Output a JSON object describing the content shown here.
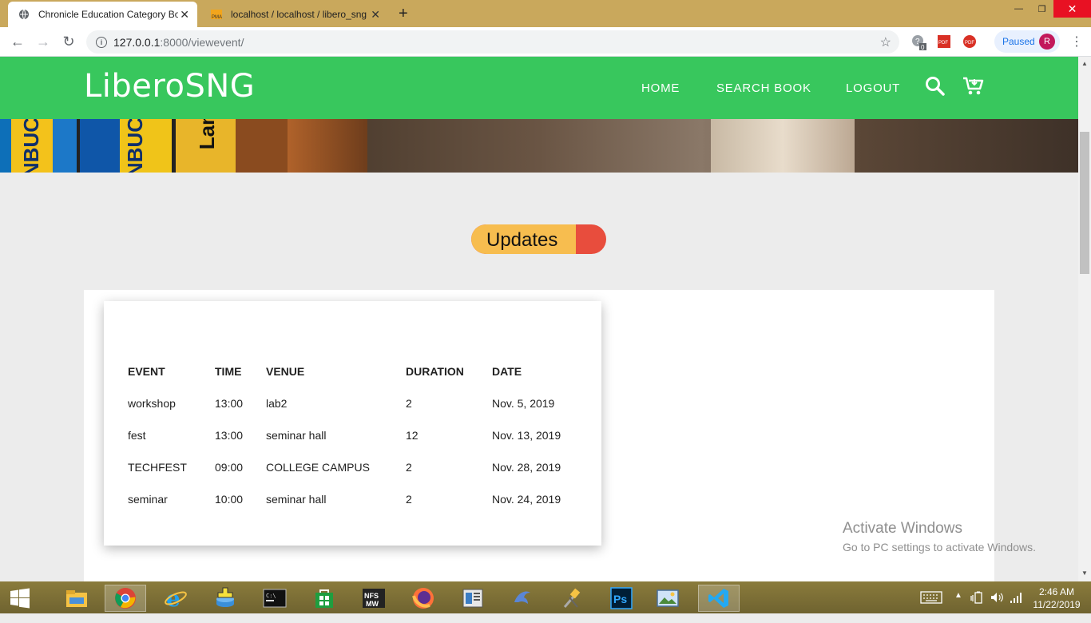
{
  "browser": {
    "tabs": [
      {
        "title": "Chronicle Education Category Bo",
        "active": true
      },
      {
        "title": "localhost / localhost / libero_sng",
        "active": false
      }
    ],
    "url_host": "127.0.0.1",
    "url_path": ":8000/viewevent/",
    "profile_status": "Paused",
    "profile_initial": "R"
  },
  "site": {
    "logo": "LiberoSNG",
    "nav": [
      "HOME",
      "SEARCH BOOK",
      "LOGOUT"
    ]
  },
  "hero": {
    "book_texts": [
      "NBUC",
      "NBUC",
      "Lan"
    ]
  },
  "updates_label": "Updates",
  "events_table": {
    "headers": [
      "EVENT",
      "TIME",
      "VENUE",
      "DURATION",
      "DATE"
    ],
    "rows": [
      [
        "workshop",
        "13:00",
        "lab2",
        "2",
        "Nov. 5, 2019"
      ],
      [
        "fest",
        "13:00",
        "seminar hall",
        "12",
        "Nov. 13, 2019"
      ],
      [
        "TECHFEST",
        "09:00",
        "COLLEGE CAMPUS",
        "2",
        "Nov. 28, 2019"
      ],
      [
        "seminar",
        "10:00",
        "seminar hall",
        "2",
        "Nov. 24, 2019"
      ]
    ]
  },
  "watermark": {
    "title": "Activate Windows",
    "subtitle": "Go to PC settings to activate Windows."
  },
  "taskbar": {
    "time": "2:46 AM",
    "date": "11/22/2019"
  },
  "colors": {
    "header_green": "#38c75d",
    "updates_yellow": "#f7bd4f",
    "updates_red": "#e84d3d"
  }
}
